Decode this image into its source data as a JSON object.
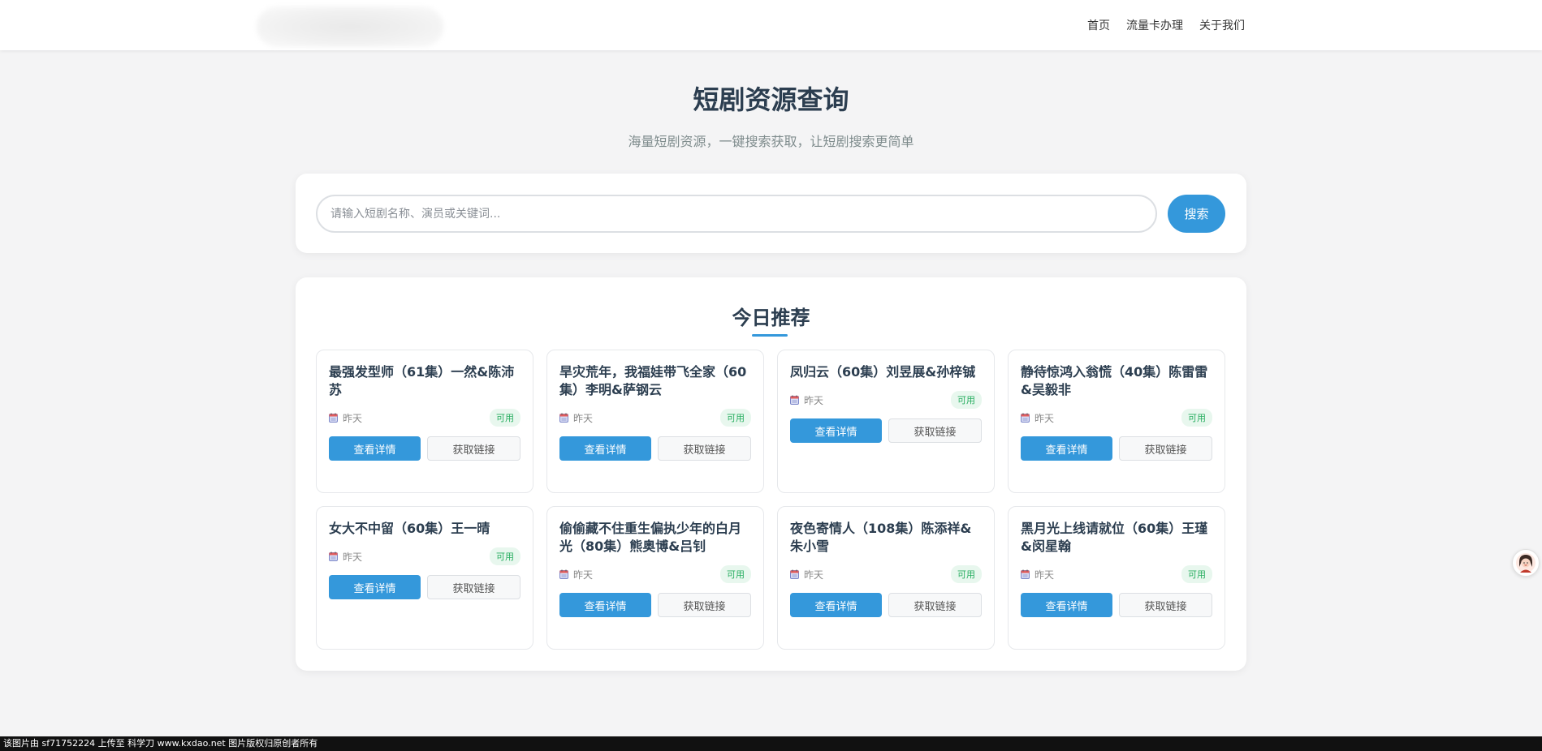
{
  "header": {
    "nav": [
      "首页",
      "流量卡办理",
      "关于我们"
    ]
  },
  "hero": {
    "title": "短剧资源查询",
    "subtitle": "海量短剧资源，一键搜索获取，让短剧搜索更简单"
  },
  "search": {
    "placeholder": "请输入短剧名称、演员或关键词...",
    "button": "搜索"
  },
  "recommend": {
    "title": "今日推荐",
    "detail_label": "查看详情",
    "link_label": "获取链接",
    "items": [
      {
        "title": "最强发型师（61集）一然&陈沛苏",
        "date": "昨天",
        "status": "可用"
      },
      {
        "title": "旱灾荒年，我福娃带飞全家（60集）李明&萨钢云",
        "date": "昨天",
        "status": "可用"
      },
      {
        "title": "凤归云（60集）刘昱展&孙梓铖",
        "date": "昨天",
        "status": "可用"
      },
      {
        "title": "静待惊鸿入翁慌（40集）陈雷雷&吴毅非",
        "date": "昨天",
        "status": "可用"
      },
      {
        "title": "女大不中留（60集）王一晴",
        "date": "昨天",
        "status": "可用"
      },
      {
        "title": "偷偷藏不住重生偏执少年的白月光（80集）熊奥博&吕钊",
        "date": "昨天",
        "status": "可用"
      },
      {
        "title": "夜色寄情人（108集）陈添祥&朱小雪",
        "date": "昨天",
        "status": "可用"
      },
      {
        "title": "黑月光上线请就位（60集）王瑾&闵星翰",
        "date": "昨天",
        "status": "可用"
      }
    ]
  },
  "footer": {
    "text": "该图片由 sf71752224 上传至 科学刀 www.kxdao.net 图片版权归原创者所有"
  },
  "colors": {
    "accent": "#3498db",
    "available": "#27ae60"
  }
}
